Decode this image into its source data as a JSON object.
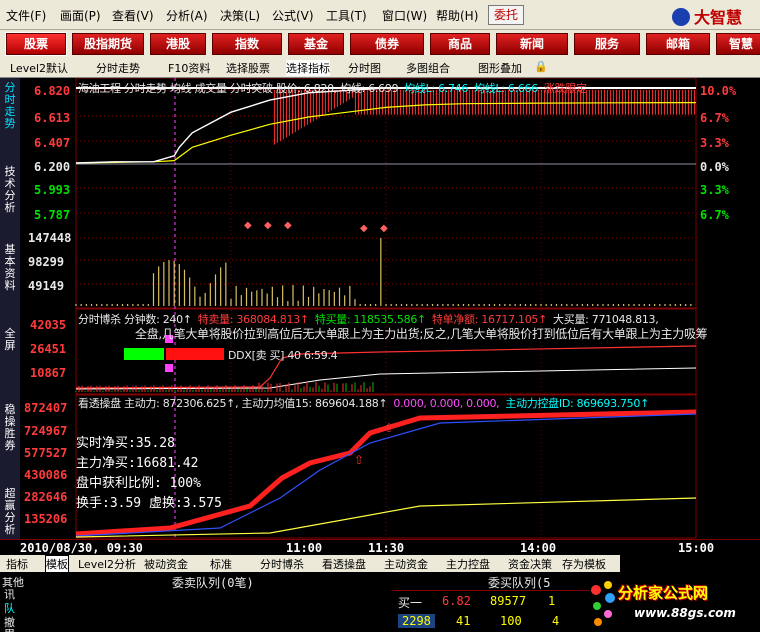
{
  "menus": [
    "文件(F)",
    "画面(P)",
    "查看(V)",
    "分析(A)",
    "决策(L)",
    "公式(V)",
    "工具(T)",
    "窗口(W)",
    "帮助(H)"
  ],
  "weituo": "委托",
  "brand": "大智慧",
  "nav": [
    "股票",
    "股指期货",
    "港股",
    "指数",
    "基金",
    "债券",
    "商品",
    "新闻",
    "服务",
    "邮箱",
    "智慧"
  ],
  "subtabs": [
    "Level2默认",
    "分时走势",
    "F10资料",
    "选择股票",
    "选择指标",
    "分时图",
    "多图组合",
    "图形叠加"
  ],
  "sidebar": [
    "分时走势",
    "技术分析",
    "基本资料",
    "全屏",
    "稳操胜券",
    "超赢分析"
  ],
  "price_chart": {
    "header": [
      {
        "t": "海油工程 分时走势  均线  成交量  分时突破  股价: 6.820, 均线: 6.699",
        "c": "wht"
      },
      {
        "t": "均线L: 6.746",
        "c": "cyan"
      },
      {
        "t": "均线L: 6.666",
        "c": "cyan"
      },
      {
        "t": "涨跌限定",
        "c": "red"
      }
    ],
    "left_ticks": [
      "6.820",
      "6.613",
      "6.407",
      "6.200",
      "5.993",
      "5.787"
    ],
    "right_ticks": [
      "10.0%",
      "6.7%",
      "3.3%",
      "0.0%",
      "3.3%",
      "6.7%"
    ],
    "vol_ticks": [
      "147448",
      "98299",
      "49149"
    ],
    "prev_close": 6.2,
    "limit_up": 6.82,
    "series": {
      "time": [
        "09:30",
        "09:45",
        "10:00",
        "10:08",
        "10:10",
        "10:15",
        "10:30",
        "10:45",
        "11:00",
        "11:15",
        "11:30",
        "13:15",
        "13:30",
        "14:00",
        "14:30",
        "15:00"
      ],
      "price": [
        6.2,
        6.21,
        6.21,
        6.26,
        6.33,
        6.45,
        6.62,
        6.72,
        6.78,
        6.8,
        6.82,
        6.82,
        6.82,
        6.82,
        6.82,
        6.82
      ],
      "avg": [
        6.2,
        6.205,
        6.21,
        6.22,
        6.25,
        6.33,
        6.43,
        6.52,
        6.58,
        6.62,
        6.66,
        6.68,
        6.69,
        6.695,
        6.698,
        6.699
      ]
    }
  },
  "ddx_panel": {
    "header": [
      {
        "t": "分时博杀  分钟数: 240↑",
        "c": "wht"
      },
      {
        "t": "特卖量: 368084.813↑",
        "c": "red"
      },
      {
        "t": "特买量: 118535.586↑",
        "c": "grn"
      },
      {
        "t": "特单净额: 16717.105↑",
        "c": "red"
      },
      {
        "t": "大买量: 771048.813,",
        "c": "wht"
      }
    ],
    "note": "全盘,几笔大单将股价拉到高位后无大单跟上为主力出货;反之,几笔大单将股价打到低位后有大单跟上为主力吸筹",
    "ticks": [
      "42035",
      "26451",
      "10867"
    ],
    "ddx_label": "DDX[卖 买] 40 6:59.4"
  },
  "main_force": {
    "header": [
      {
        "t": "看透操盘  主动力: 872306.625↑, 主动力均值15: 869604.188↑",
        "c": "wht"
      },
      {
        "t": "0.000, 0.000, 0.000,",
        "c": "mag"
      },
      {
        "t": "主动力控盘ID: 869693.750↑",
        "c": "cyan"
      }
    ],
    "ticks": [
      "872407",
      "724967",
      "577527",
      "430086",
      "282646",
      "135206"
    ],
    "stats": [
      "实时净买:35.28",
      "主力净买:16681.42",
      "盘中获利比例: 100%",
      "换手:3.59  虚换:3.575"
    ]
  },
  "xaxis": {
    "date": "2010/08/30, 09:30",
    "labels": [
      "11:00",
      "11:30",
      "14:00",
      "15:00"
    ]
  },
  "bottom_tabs": [
    "指标",
    "模板",
    "Level2分析",
    "被动资金",
    "标准",
    "分时博杀",
    "看透操盘",
    "主动资金",
    "主力控盘",
    "资金决策",
    "存为模板"
  ],
  "queue": {
    "side_tabs": [
      "其他",
      "讯",
      "队",
      "撤",
      "累"
    ],
    "sell_title": "委卖队列(0笔)",
    "buy_title": "委买队列(5",
    "buy_row": {
      "label": "买一",
      "price": "6.82",
      "vol": "89577",
      "extra": "1"
    },
    "detail_row": {
      "n1": "2298",
      "n2": "41",
      "n3": "100",
      "n4": "4"
    }
  },
  "watermark": {
    "title": "分析家公式网",
    "url": "www.88gs.com"
  },
  "colors": {
    "up": "#ff3b3b",
    "down": "#00e000",
    "avg": "#ffff00",
    "price": "#ffffff",
    "grid": "#800000"
  }
}
